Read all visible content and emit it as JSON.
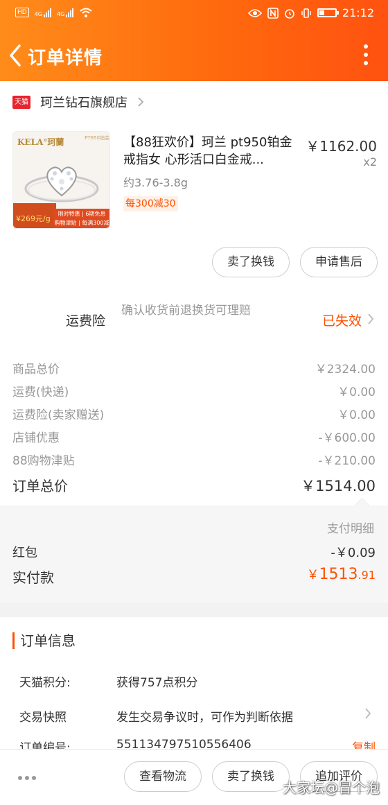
{
  "status_bar": {
    "hd": "HD",
    "net1": "4G",
    "net2": "4G",
    "time": "21:12"
  },
  "header": {
    "title": "订单详情"
  },
  "shop": {
    "badge": "天猫",
    "name": "珂兰钻石旗舰店"
  },
  "product": {
    "thumb_brand": "KELA°珂蘭",
    "thumb_tag": "PT950铂金",
    "thumb_price": "¥269元/g",
    "thumb_promo_1": "限时特惠 | 6期免息",
    "thumb_promo_2": "购物津贴 | 每满300减30",
    "title": "【88狂欢价】珂兰 pt950铂金戒指女 心形活口白金戒...",
    "spec": "约3.76-3.8g",
    "promo_tag": "每300减30",
    "price": "￥1162.00",
    "qty": "x2"
  },
  "item_actions": {
    "sell": "卖了换钱",
    "after_sale": "申请售后"
  },
  "insurance": {
    "label": "运费险",
    "desc": "确认收货前退换货可理赔",
    "status": "已失效"
  },
  "costs": [
    {
      "label": "商品总价",
      "value": "￥2324.00"
    },
    {
      "label": "运费(快递)",
      "value": "￥0.00"
    },
    {
      "label": "运费险(卖家赠送)",
      "value": "￥0.00"
    },
    {
      "label": "店铺优惠",
      "value": "-￥600.00"
    },
    {
      "label": "88购物津贴",
      "value": "-￥210.00"
    }
  ],
  "total": {
    "label": "订单总价",
    "value": "￥1514.00"
  },
  "payment": {
    "detail_link": "支付明细",
    "hongbao_label": "红包",
    "hongbao_value": "-￥0.09",
    "paid_label": "实付款",
    "paid_currency": "￥",
    "paid_int": "1513",
    "paid_dec": ".91"
  },
  "order_info": {
    "title": "订单信息",
    "points_label": "天猫积分:",
    "points_value": "获得757点积分",
    "snapshot_label": "交易快照",
    "snapshot_value": "发生交易争议时，可作为判断依据",
    "number_label": "订单编号:",
    "number_value": "551134797510556406",
    "copy_label": "复制"
  },
  "bottom_bar": {
    "logistics": "查看物流",
    "sell": "卖了换钱",
    "review": "追加评价"
  },
  "watermark": "大家坛@冒个泡",
  "colors": {
    "accent": "#ff5000",
    "header_start": "#ff8c1a",
    "header_end": "#ff5210"
  }
}
